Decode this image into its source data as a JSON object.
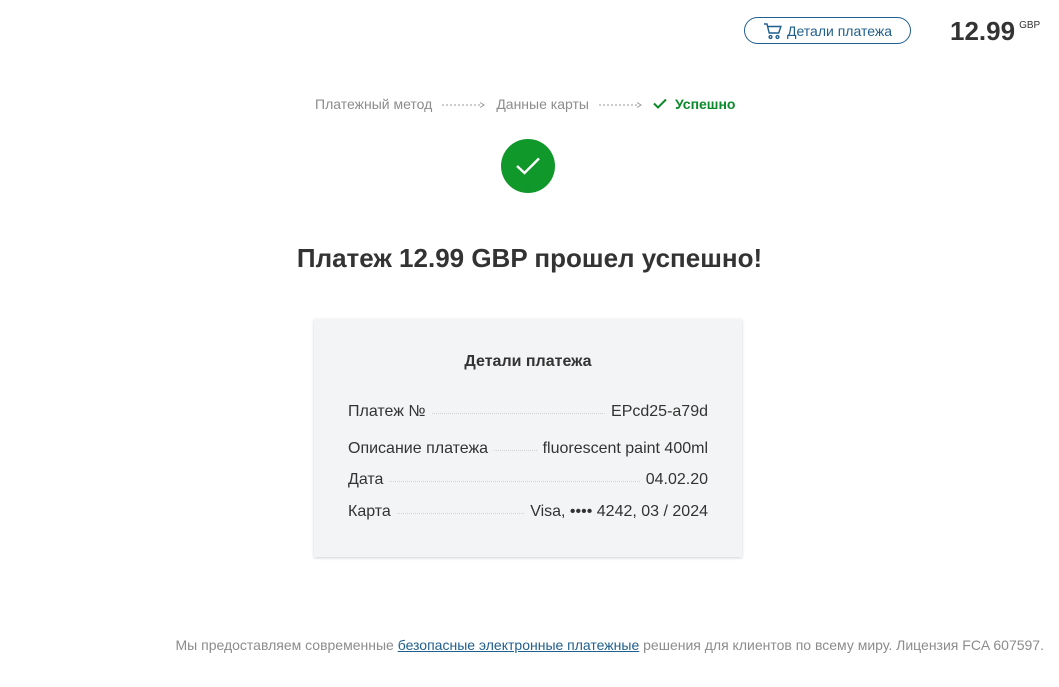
{
  "header": {
    "details_button_label": "Детали платежа",
    "amount": "12.99",
    "currency": "GBP"
  },
  "steps": [
    {
      "label": "Платежный метод"
    },
    {
      "label": "Данные карты"
    },
    {
      "label": "Успешно"
    }
  ],
  "success_title": "Платеж 12.99 GBP прошел успешно!",
  "card": {
    "title": "Детали платежа",
    "rows": [
      {
        "label": "Платеж №",
        "value": "EPcd25-a79d"
      },
      {
        "label": "Описание платежа",
        "value": "fluorescent paint 400ml"
      },
      {
        "label": "Дата",
        "value": "04.02.20"
      },
      {
        "label": "Карта",
        "value": "Visa, •••• 4242, 03 / 2024"
      }
    ]
  },
  "footer": {
    "text_before": "Мы предоставляем современные ",
    "link_text": "безопасные электронные платежные",
    "text_after": " решения для клиентов по всему миру. Лицензия FCA 607597."
  },
  "colors": {
    "accent": "#1f5f8f",
    "success": "#10982b",
    "muted": "#8c8c8c"
  }
}
